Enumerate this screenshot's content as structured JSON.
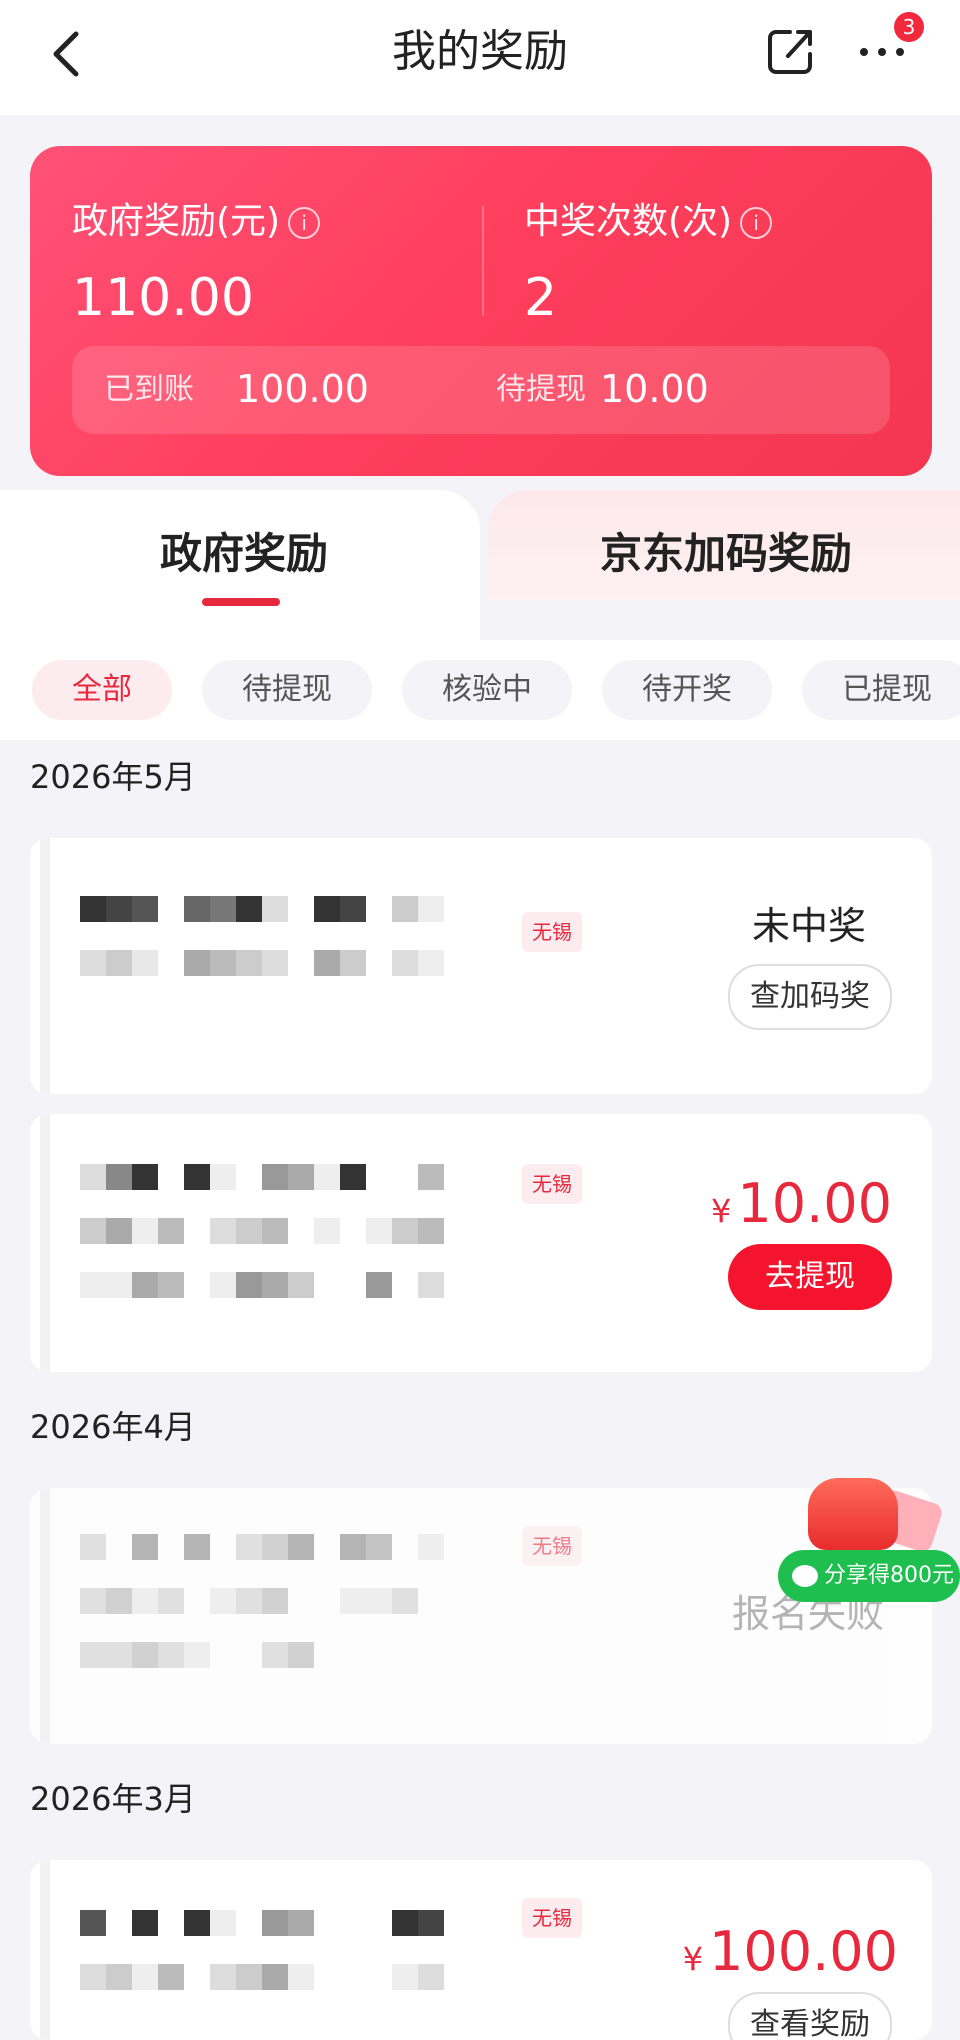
{
  "header": {
    "title": "我的奖励",
    "notification_count": "3"
  },
  "summary": {
    "gov_reward_label": "政府奖励(元)",
    "gov_reward_value": "110.00",
    "win_count_label": "中奖次数(次)",
    "win_count_value": "2",
    "received_label": "已到账",
    "received_value": "100.00",
    "pending_label": "待提现",
    "pending_value": "10.00",
    "info_glyph": "i"
  },
  "tabs": {
    "gov": "政府奖励",
    "jd": "京东加码奖励"
  },
  "filters": [
    "全部",
    "待提现",
    "核验中",
    "待开奖",
    "已提现"
  ],
  "months": {
    "may": "2026年5月",
    "apr": "2026年4月",
    "mar": "2026年3月"
  },
  "cards": {
    "c1": {
      "tag": "无锡",
      "status": "未中奖",
      "button": "查加码奖"
    },
    "c2": {
      "tag": "无锡",
      "currency": "¥",
      "amount": "10.00",
      "button": "去提现"
    },
    "c3": {
      "tag": "无锡",
      "status": "报名失败"
    },
    "c4": {
      "tag": "无锡",
      "currency": "¥",
      "amount": "100.00",
      "button": "查看奖励"
    }
  },
  "promo": {
    "label": "分享得800元"
  },
  "colors": {
    "accent": "#e8283c",
    "card_gradient_start": "#ff5177",
    "card_gradient_end": "#f33651",
    "promo_green": "#1ebf4f"
  }
}
